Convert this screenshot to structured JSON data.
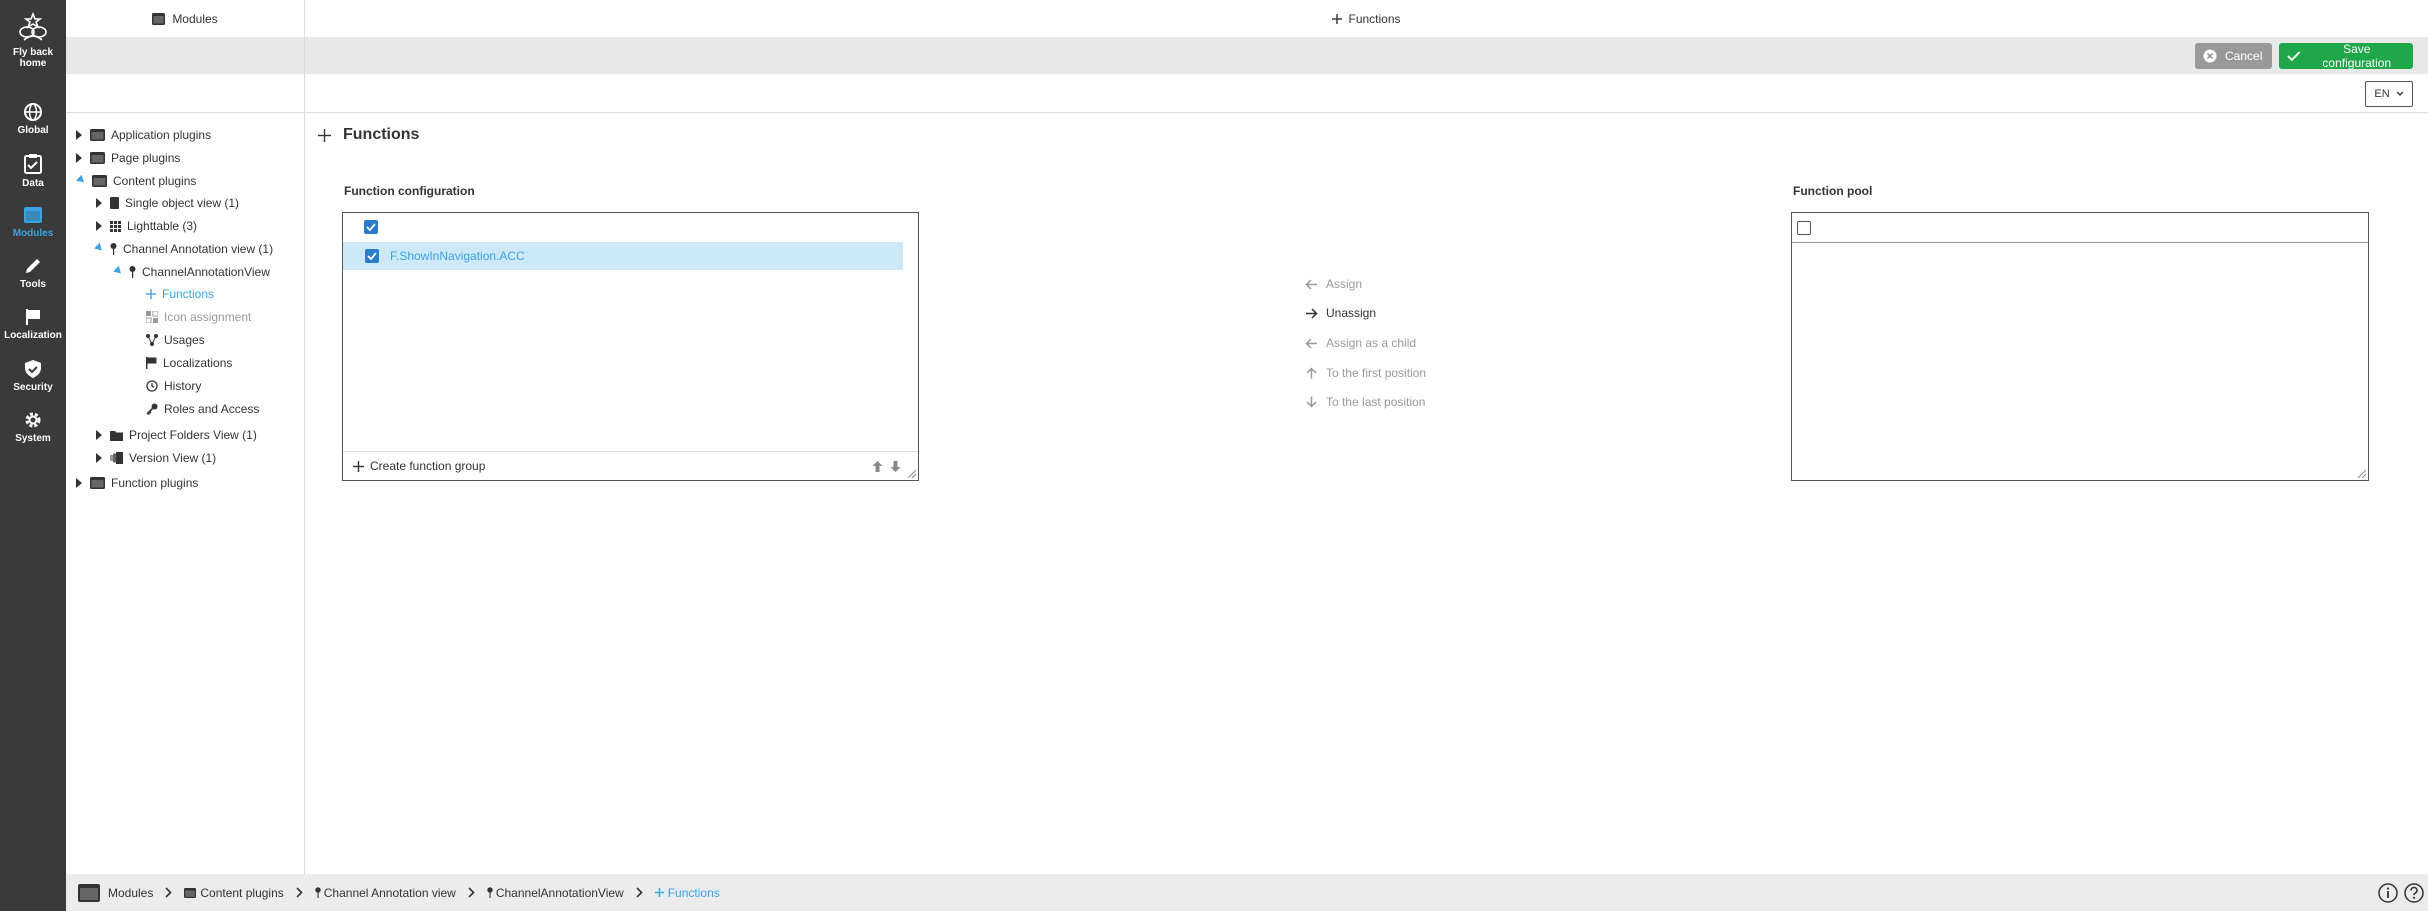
{
  "nav": {
    "items": [
      {
        "id": "home",
        "label_lines": [
          "Fly back",
          "home"
        ],
        "icon": "bee-logo-icon"
      },
      {
        "id": "global",
        "label_lines": [
          "Global"
        ],
        "icon": "globe-icon"
      },
      {
        "id": "data",
        "label_lines": [
          "Data"
        ],
        "icon": "checklist-icon"
      },
      {
        "id": "modules",
        "label_lines": [
          "Modules"
        ],
        "icon": "window-icon"
      },
      {
        "id": "tools",
        "label_lines": [
          "Tools"
        ],
        "icon": "pencil-icon"
      },
      {
        "id": "localization",
        "label_lines": [
          "Localization"
        ],
        "icon": "flag-icon"
      },
      {
        "id": "security",
        "label_lines": [
          "Security"
        ],
        "icon": "shield-check-icon"
      },
      {
        "id": "system",
        "label_lines": [
          "System"
        ],
        "icon": "gear-icon"
      }
    ],
    "active": "modules",
    "active_color": "#3aa3e3"
  },
  "tree_panel": {
    "title": "Modules",
    "items": [
      {
        "label": "Application plugins",
        "state": "collapsed",
        "icon": "window-icon"
      },
      {
        "label": "Page plugins",
        "state": "collapsed",
        "icon": "window-icon"
      },
      {
        "label": "Content plugins",
        "state": "expanded",
        "icon": "window-icon"
      },
      {
        "label": "Single object view (1)",
        "state": "collapsed",
        "icon": "document-icon"
      },
      {
        "label": "Lighttable (3)",
        "state": "collapsed",
        "icon": "grid-icon"
      },
      {
        "label": "Channel Annotation view (1)",
        "state": "expanded",
        "icon": "pin-icon"
      },
      {
        "label": "ChannelAnnotationView",
        "state": "expanded",
        "icon": "pin-icon"
      },
      {
        "label": "Functions",
        "state": "selected",
        "icon": "plus-icon"
      },
      {
        "label": "Icon assignment",
        "state": "disabled",
        "icon": "icon-assign-icon"
      },
      {
        "label": "Usages",
        "state": "leaf",
        "icon": "share-icon"
      },
      {
        "label": "Localizations",
        "state": "leaf",
        "icon": "flag-icon"
      },
      {
        "label": "History",
        "state": "leaf",
        "icon": "history-icon"
      },
      {
        "label": "Roles and Access",
        "state": "leaf",
        "icon": "key-icon"
      },
      {
        "label": "Project Folders View (1)",
        "state": "collapsed",
        "icon": "folder-icon"
      },
      {
        "label": "Version View (1)",
        "state": "collapsed",
        "icon": "versions-icon"
      },
      {
        "label": "Function plugins",
        "state": "collapsed",
        "icon": "window-icon"
      }
    ]
  },
  "header": {
    "title": "Functions",
    "cancel_label": "Cancel",
    "save_label": "Save configuration",
    "language": "EN"
  },
  "content": {
    "section_title": "Functions",
    "function_config": {
      "label": "Function configuration",
      "select_all_checked": true,
      "items": [
        {
          "label": "F.ShowInNavigation.ACC",
          "checked": true,
          "selected": true
        }
      ],
      "create_group_label": "Create function group"
    },
    "actions": [
      {
        "label": "Assign",
        "enabled": false,
        "icon": "arrow-left-icon"
      },
      {
        "label": "Unassign",
        "enabled": true,
        "icon": "arrow-right-icon"
      },
      {
        "label": "Assign as a child",
        "enabled": false,
        "icon": "arrow-left-icon"
      },
      {
        "label": "To the first position",
        "enabled": false,
        "icon": "arrow-up-icon"
      },
      {
        "label": "To the last position",
        "enabled": false,
        "icon": "arrow-down-icon"
      }
    ],
    "function_pool": {
      "label": "Function pool",
      "select_all_checked": false,
      "items": []
    }
  },
  "breadcrumb": [
    {
      "label": "Modules",
      "icon": "window-icon"
    },
    {
      "label": "Content plugins",
      "icon": "window-icon"
    },
    {
      "label": "Channel Annotation view",
      "icon": "pin-icon"
    },
    {
      "label": "ChannelAnnotationView",
      "icon": "pin-icon"
    },
    {
      "label": "Functions",
      "icon": "plus-icon",
      "current": true
    }
  ],
  "footer_icons": [
    "info-icon",
    "help-icon"
  ],
  "colors": {
    "accent": "#3aa3e3",
    "save": "#1fa84a",
    "cancel": "#999999",
    "nav_bg": "#3a3a3a",
    "selection_bg": "#cde9f8",
    "checkbox": "#2a7cc7"
  }
}
